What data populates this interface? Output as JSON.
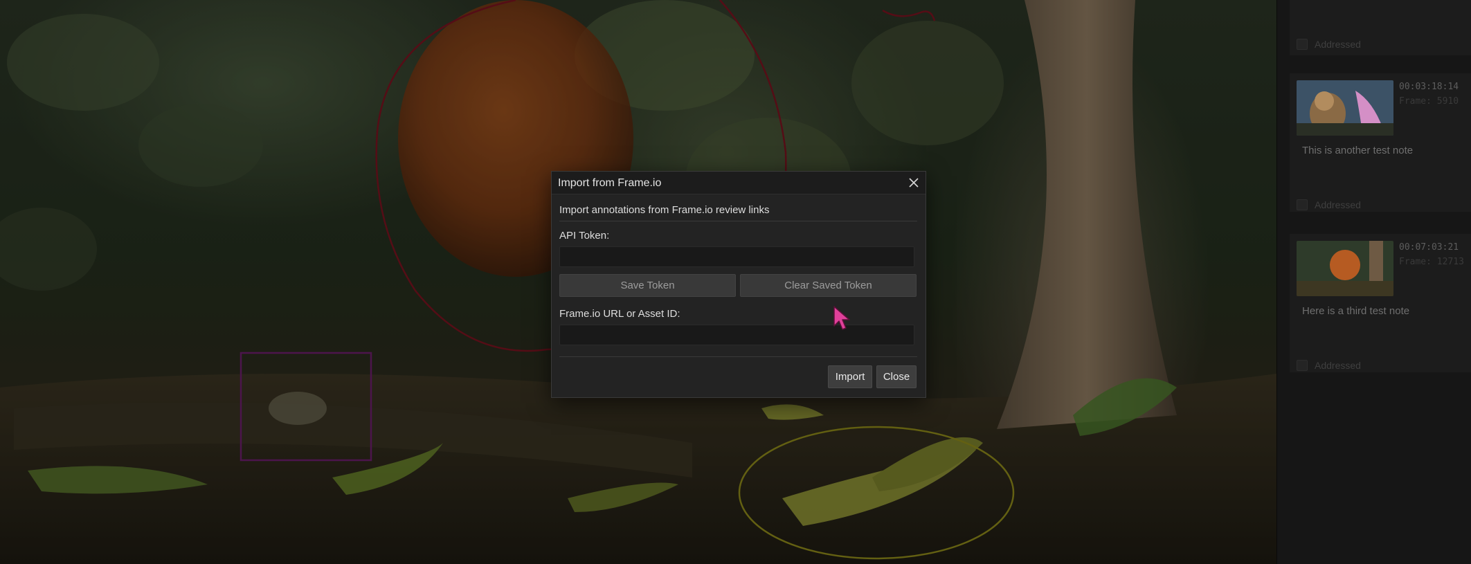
{
  "dialog": {
    "title": "Import from Frame.io",
    "description": "Import annotations from Frame.io review links",
    "api_token_label": "API Token:",
    "api_token_value": "",
    "save_token_label": "Save Token",
    "clear_token_label": "Clear Saved Token",
    "url_label": "Frame.io URL or Asset ID:",
    "url_value": "",
    "import_label": "Import",
    "close_label": "Close",
    "close_icon": "close-icon"
  },
  "notes": [
    {
      "timecode": "",
      "frame": "",
      "text": "",
      "status": "Addressed"
    },
    {
      "timecode": "00:03:18:14",
      "frame": "Frame: 5910",
      "text": "This is another test note",
      "status": "Addressed"
    },
    {
      "timecode": "00:07:03:21",
      "frame": "Frame: 12713",
      "text": "Here is a third test note",
      "status": "Addressed"
    }
  ],
  "colors": {
    "annotation_red": "#7a1320",
    "annotation_purple": "#6e1f6e",
    "annotation_yellow": "#8f8a1a",
    "cursor_pink": "#e0409a",
    "panel_bg": "#161616",
    "dialog_bg": "#232323"
  }
}
